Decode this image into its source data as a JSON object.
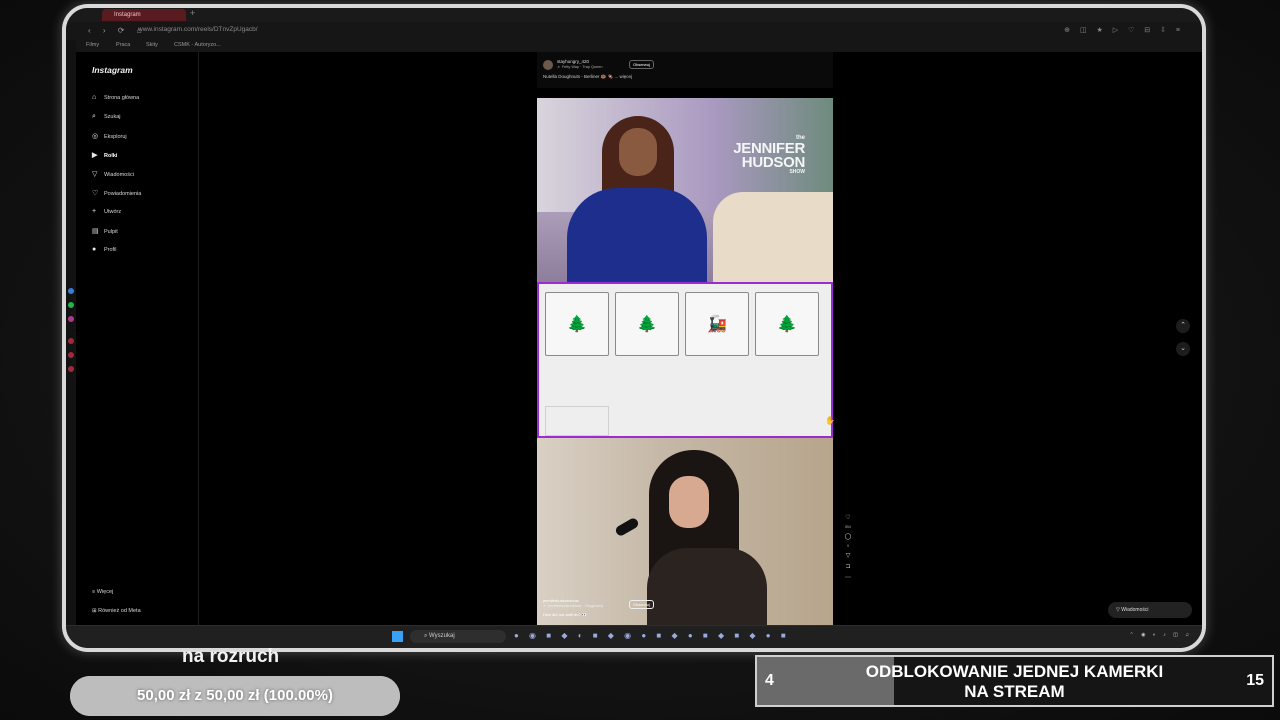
{
  "browser": {
    "tab_title": "Instagram",
    "url": "www.instagram.com/reels/DTnvZpUgacb/",
    "bookmarks": [
      "Filmy",
      "Praca",
      "Skity",
      "CSMK - Autoryzo..."
    ]
  },
  "instagram": {
    "logo": "Instagram",
    "nav": [
      {
        "label": "Strona główna",
        "icon": "home-icon"
      },
      {
        "label": "Szukaj",
        "icon": "search-icon"
      },
      {
        "label": "Eksploruj",
        "icon": "compass-icon"
      },
      {
        "label": "Rolki",
        "icon": "reels-icon"
      },
      {
        "label": "Wiadomości",
        "icon": "send-icon"
      },
      {
        "label": "Powiadomienia",
        "icon": "heart-icon"
      },
      {
        "label": "Utwórz",
        "icon": "plus-icon"
      },
      {
        "label": "Pulpit",
        "icon": "dashboard-icon"
      },
      {
        "label": "Profil",
        "icon": "profile-icon"
      }
    ],
    "more": "Więcej",
    "meta": "Również od Meta",
    "messages": "Wiadomości"
  },
  "reel1": {
    "user": "stayhungry_420",
    "song": "♬ Fetty Wap · Trap Queen",
    "follow": "Obserwuj",
    "caption": "Nutella Doughnuts - Berliner 🍩 🍫 ... więcej",
    "show_the": "the",
    "show_name_1": "JENNIFER",
    "show_name_2": "HUDSON",
    "show_sub": "SHOW"
  },
  "game": {
    "cards": [
      "🌲",
      "🌲",
      "🚂",
      "🌲"
    ]
  },
  "reel2": {
    "user": "jenniferhudsonshow",
    "song": "♬ jenniferhudsonshow · Oryginalny",
    "follow": "Obserwuj",
    "caption": "How did our staff do? 👀",
    "likes": "854",
    "comments": "9"
  },
  "taskbar": {
    "search_placeholder": "Wyszukaj"
  },
  "overlay": {
    "goal_title": "na rozruch",
    "progress_text": "50,00 zł z 50,00 zł (100.00%)",
    "progress_fraction": 1.0,
    "counter_title_1": "ODBLOKOWANIE JEDNEJ KAMERKI",
    "counter_title_2": "NA STREAM",
    "counter_current": "4",
    "counter_target": "15",
    "counter_fraction": 0.2667
  }
}
